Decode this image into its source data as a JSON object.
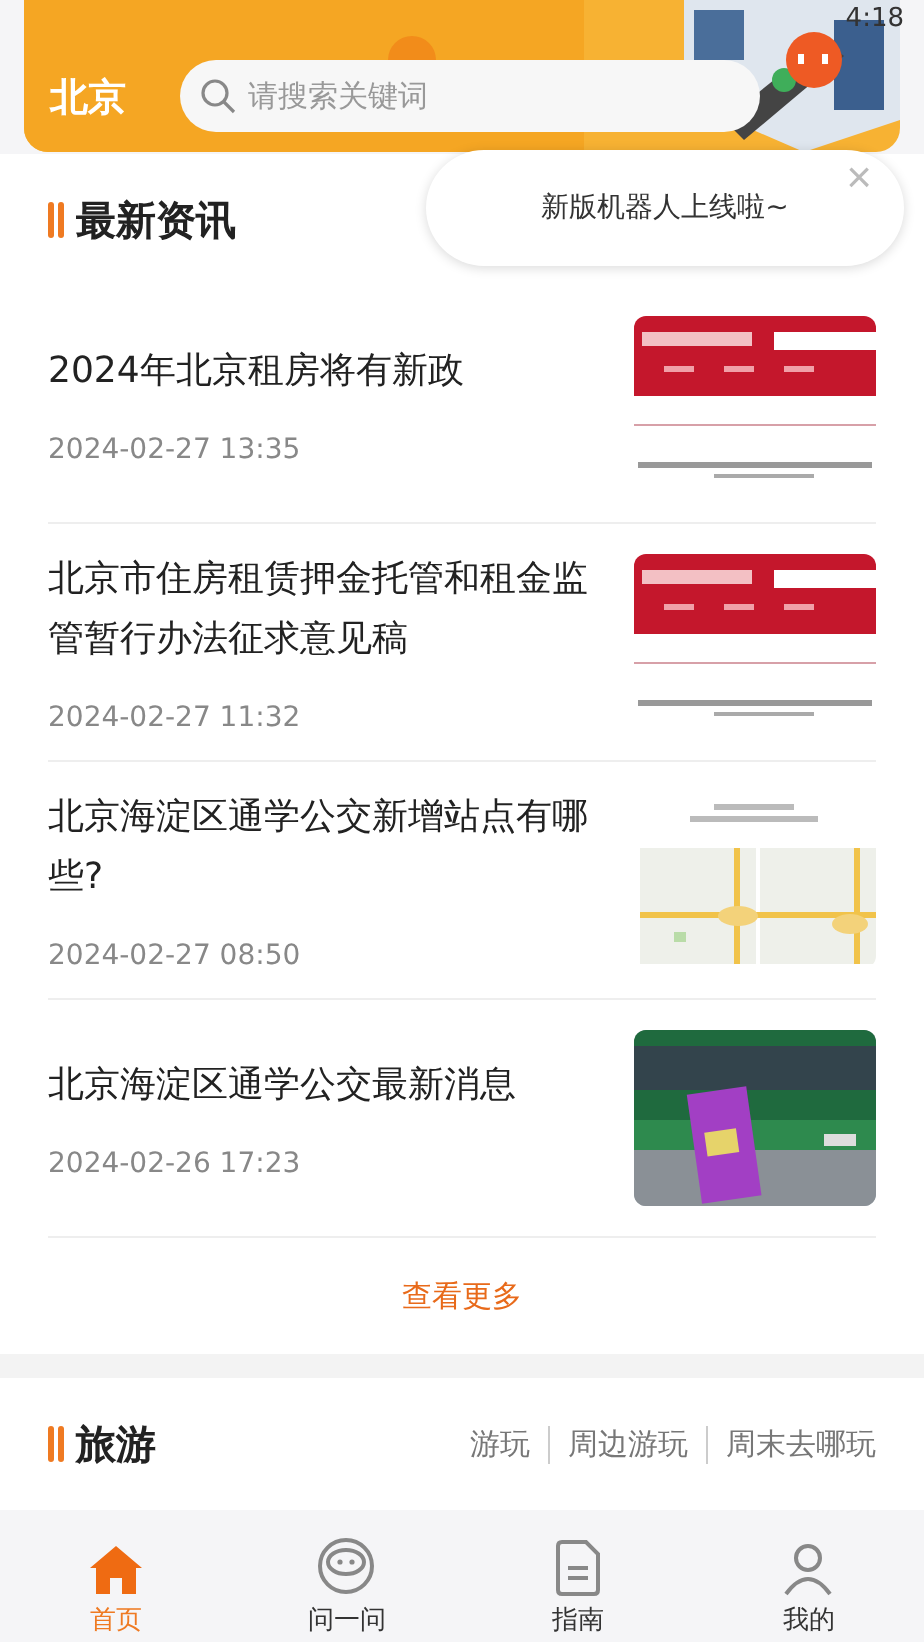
{
  "status_bar": {
    "time": "4:18"
  },
  "header": {
    "city": "北京",
    "search": {
      "placeholder": "请搜索关键词"
    }
  },
  "popup": {
    "message": "新版机器人上线啦~",
    "close": "×"
  },
  "news": {
    "title": "最新资讯",
    "items": [
      {
        "title": "2024年北京租房将有新政",
        "date": "2024-02-27 13:35"
      },
      {
        "title": "北京市住房租赁押金托管和租金监管暂行办法征求意见稿",
        "date": "2024-02-27 11:32"
      },
      {
        "title": "北京海淀区通学公交新增站点有哪些?",
        "date": "2024-02-27 08:50"
      },
      {
        "title": "北京海淀区通学公交最新消息",
        "date": "2024-02-26 17:23"
      }
    ],
    "more": "查看更多"
  },
  "travel": {
    "title": "旅游",
    "tabs": [
      "游玩",
      "周边游玩",
      "周末去哪玩"
    ]
  },
  "tab_bar": [
    {
      "label": "首页",
      "selected": true
    },
    {
      "label": "问一问",
      "selected": false
    },
    {
      "label": "指南",
      "selected": false
    },
    {
      "label": "我的",
      "selected": false
    }
  ]
}
